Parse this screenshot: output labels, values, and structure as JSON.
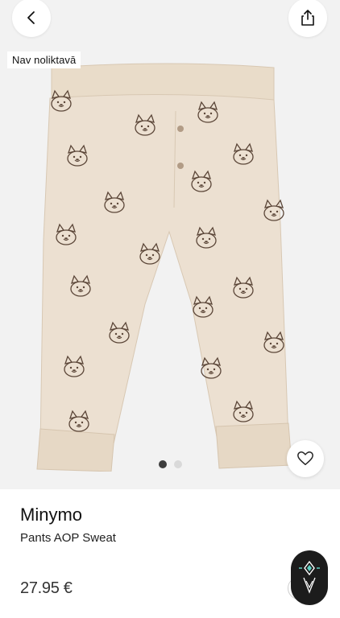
{
  "header": {
    "back_icon": "chevron-left-icon",
    "share_icon": "share-icon"
  },
  "gallery": {
    "badge": "Nav noliktavā",
    "image_subject": "beige baby pants with dog face print",
    "colors": {
      "fabric": "#ece0d1",
      "print": "#5b4638"
    },
    "dots": {
      "count": 2,
      "active_index": 0
    },
    "wishlist_icon": "heart-outline-icon"
  },
  "product": {
    "brand": "Minymo",
    "name": "Pants AOP Sweat",
    "price": "27.95 €"
  },
  "floating_widget": {
    "icon": "diamond-logo-icon"
  }
}
